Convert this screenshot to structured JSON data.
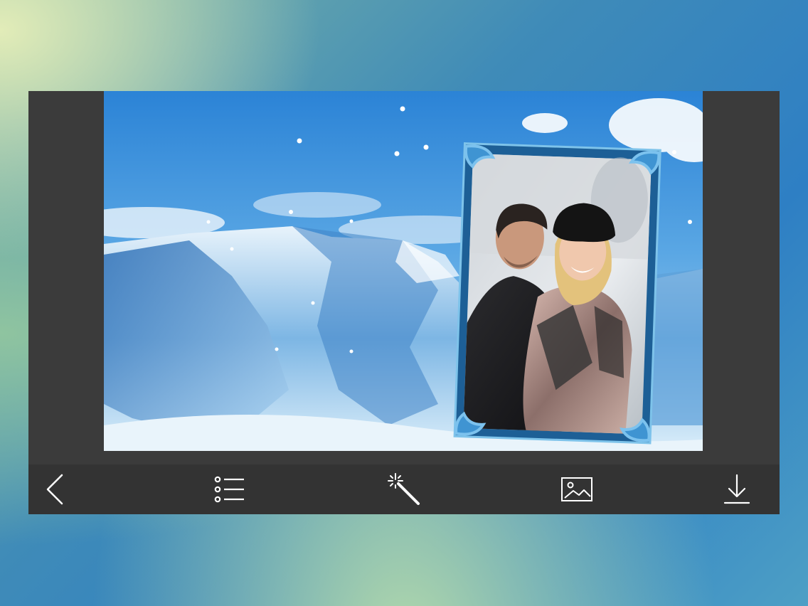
{
  "app": {
    "screen": "photo-frame-editor"
  },
  "canvas": {
    "background_scene": "snowy-mountain-sky",
    "frame_style": "blue-ornate-frame",
    "photo_subject": "couple-portrait"
  },
  "toolbar": {
    "items": [
      {
        "icon": "back-chevron-icon"
      },
      {
        "icon": "list-icon"
      },
      {
        "icon": "magic-wand-icon"
      },
      {
        "icon": "image-icon"
      },
      {
        "icon": "download-icon"
      }
    ]
  },
  "colors": {
    "toolbar_bg": "#333333",
    "frame_bg": "#3b3b3b",
    "icon_color": "#ffffff",
    "sky_top": "#2f86d6",
    "ornament_blue": "#4aa3dc"
  }
}
